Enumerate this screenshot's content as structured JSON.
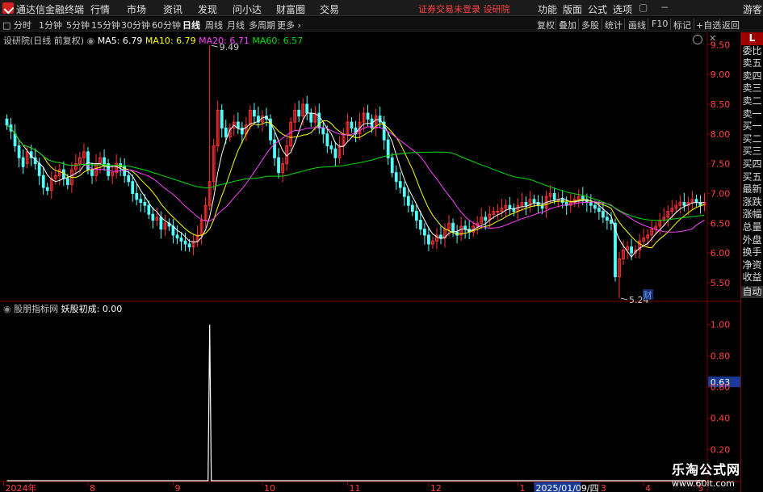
{
  "menubar": {
    "app_title": "通达信金融终端",
    "items": [
      "行情",
      "市场",
      "资讯",
      "发现",
      "问小达",
      "财富圈",
      "交易"
    ],
    "notice": "证券交易未登录  设研院",
    "right_items": [
      "功能",
      "版面",
      "公式",
      "选项"
    ],
    "guest": "游客"
  },
  "toolbar": {
    "periods": [
      "分时",
      "1分钟",
      "5分钟",
      "15分钟",
      "30分钟",
      "60分钟",
      "日线",
      "周线",
      "月线",
      "多周期",
      "更多"
    ],
    "active_period": "日线",
    "buttons": [
      "复权",
      "叠加",
      "多股",
      "统计",
      "画线",
      "F10",
      "标记",
      "+自选",
      "返回"
    ]
  },
  "main_chart": {
    "stock_label": "设研院(日线 前复权)",
    "ma": [
      {
        "name": "MA5",
        "value": "6.79",
        "color": "#ffffff"
      },
      {
        "name": "MA10",
        "value": "6.79",
        "color": "#ffff00"
      },
      {
        "name": "MA20",
        "value": "6.71",
        "color": "#ff40ff"
      },
      {
        "name": "MA60",
        "value": "6.57",
        "color": "#00e000"
      }
    ],
    "price_ticks": [
      "9.50",
      "9.00",
      "8.50",
      "8.00",
      "7.50",
      "7.00",
      "6.50",
      "6.00",
      "5.50"
    ],
    "high_label": "9.49",
    "low_label": "5.24",
    "event_mark": "财"
  },
  "sub_chart": {
    "indicator": "股朋指标网",
    "line_name": "妖股初成",
    "value": "0.00",
    "ticks": [
      "1.00",
      "0.80",
      "0.63",
      "0.60",
      "0.40",
      "0.20"
    ],
    "highlight": "0.63"
  },
  "date_axis": {
    "labels": [
      "2024年",
      "8",
      "9",
      "10",
      "11",
      "12",
      "1",
      "2025/01/09/四",
      "3",
      "4",
      "5"
    ]
  },
  "right_panel": [
    "L",
    "委比",
    "卖五",
    "卖四",
    "卖三",
    "卖二",
    "卖一",
    "买一",
    "买二",
    "买三",
    "买四",
    "买五",
    "最新",
    "涨跌",
    "涨幅",
    "总量",
    "外盘",
    "换手",
    "净资",
    "收益",
    "自动"
  ],
  "watermark": {
    "title": "乐淘公式网",
    "url": "www.60lt.com"
  },
  "colors": {
    "up": "#ff3232",
    "down": "#54ffff",
    "axis": "#800000",
    "grid": "#800000"
  },
  "chart_data": {
    "type": "candlestick",
    "close": [
      8.15,
      8.05,
      7.8,
      7.6,
      7.45,
      7.7,
      7.6,
      7.5,
      7.3,
      7.1,
      7.05,
      7.25,
      7.3,
      7.4,
      7.25,
      7.15,
      7.4,
      7.5,
      7.6,
      7.7,
      7.4,
      7.3,
      7.5,
      7.6,
      7.5,
      7.3,
      7.35,
      7.5,
      7.45,
      7.3,
      7.2,
      7.0,
      6.9,
      6.85,
      6.8,
      6.65,
      6.55,
      6.6,
      6.4,
      6.5,
      6.45,
      6.3,
      6.25,
      6.2,
      6.15,
      6.1,
      6.2,
      6.3,
      6.55,
      6.8,
      7.2,
      7.8,
      8.4,
      8.1,
      7.95,
      8.1,
      8.2,
      8.1,
      8.0,
      8.15,
      8.4,
      8.3,
      8.2,
      8.3,
      8.25,
      7.9,
      7.6,
      7.35,
      7.5,
      7.8,
      8.2,
      8.4,
      8.3,
      8.5,
      8.35,
      8.2,
      8.35,
      8.1,
      8.0,
      7.8,
      7.75,
      7.6,
      7.8,
      8.0,
      8.2,
      8.1,
      8.0,
      8.2,
      8.35,
      8.25,
      8.1,
      8.3,
      8.2,
      7.9,
      7.6,
      7.35,
      7.2,
      7.1,
      6.95,
      6.8,
      6.7,
      6.55,
      6.4,
      6.3,
      6.15,
      6.2,
      6.3,
      6.25,
      6.4,
      6.5,
      6.35,
      6.3,
      6.45,
      6.4,
      6.35,
      6.45,
      6.5,
      6.6,
      6.55,
      6.65,
      6.7,
      6.7,
      6.75,
      6.8,
      6.75,
      6.7,
      6.8,
      6.85,
      6.8,
      6.9,
      6.85,
      6.8,
      6.75,
      6.95,
      7.0,
      6.9,
      6.9,
      6.85,
      6.8,
      6.85,
      6.9,
      6.95,
      6.9,
      6.85,
      6.8,
      6.75,
      6.7,
      6.6,
      6.55,
      6.5,
      5.6,
      5.9,
      6.05,
      6.1,
      6.0,
      6.05,
      6.2,
      6.25,
      6.3,
      6.4,
      6.45,
      6.55,
      6.6,
      6.7,
      6.75,
      6.8,
      6.85,
      6.8,
      6.85,
      6.9,
      6.85,
      6.8,
      6.85
    ],
    "open": [
      8.25,
      8.15,
      8.0,
      7.8,
      7.6,
      7.5,
      7.7,
      7.6,
      7.5,
      7.3,
      7.1,
      7.05,
      7.25,
      7.3,
      7.4,
      7.25,
      7.15,
      7.4,
      7.5,
      7.6,
      7.7,
      7.4,
      7.3,
      7.5,
      7.6,
      7.5,
      7.3,
      7.35,
      7.5,
      7.45,
      7.3,
      7.2,
      7.0,
      6.9,
      6.85,
      6.8,
      6.65,
      6.55,
      6.6,
      6.4,
      6.5,
      6.45,
      6.3,
      6.25,
      6.2,
      6.15,
      6.1,
      6.2,
      6.3,
      6.55,
      6.8,
      7.2,
      7.8,
      8.4,
      8.1,
      7.95,
      8.1,
      8.2,
      8.1,
      8.0,
      8.15,
      8.4,
      8.3,
      8.2,
      8.3,
      8.25,
      7.9,
      7.6,
      7.35,
      7.5,
      7.8,
      8.2,
      8.4,
      8.3,
      8.5,
      8.35,
      8.2,
      8.35,
      8.1,
      8.0,
      7.8,
      7.75,
      7.6,
      7.8,
      8.0,
      8.2,
      8.1,
      8.0,
      8.2,
      8.35,
      8.25,
      8.1,
      8.3,
      8.2,
      7.9,
      7.6,
      7.35,
      7.2,
      7.1,
      6.95,
      6.8,
      6.7,
      6.55,
      6.4,
      6.3,
      6.15,
      6.2,
      6.3,
      6.25,
      6.4,
      6.5,
      6.35,
      6.3,
      6.45,
      6.4,
      6.35,
      6.45,
      6.5,
      6.6,
      6.55,
      6.65,
      6.7,
      6.7,
      6.75,
      6.8,
      6.75,
      6.7,
      6.8,
      6.85,
      6.8,
      6.9,
      6.85,
      6.8,
      6.75,
      6.95,
      7.0,
      6.9,
      6.9,
      6.85,
      6.8,
      6.85,
      6.9,
      6.95,
      6.9,
      6.85,
      6.8,
      6.75,
      6.7,
      6.6,
      6.55,
      6.5,
      5.6,
      5.9,
      6.05,
      6.1,
      6.0,
      6.05,
      6.2,
      6.25,
      6.3,
      6.4,
      6.45,
      6.55,
      6.6,
      6.7,
      6.75,
      6.8,
      6.85,
      6.8,
      6.85,
      6.9,
      6.85,
      6.8
    ],
    "ma_periods": [
      5,
      10,
      20,
      60
    ],
    "price_range": [
      5.2,
      9.6
    ],
    "spike_index": 50,
    "spike_value": 1.0,
    "spike_high": 9.49,
    "low_index": 151,
    "low_value": 5.24,
    "sub_range": [
      0,
      1.05
    ]
  }
}
